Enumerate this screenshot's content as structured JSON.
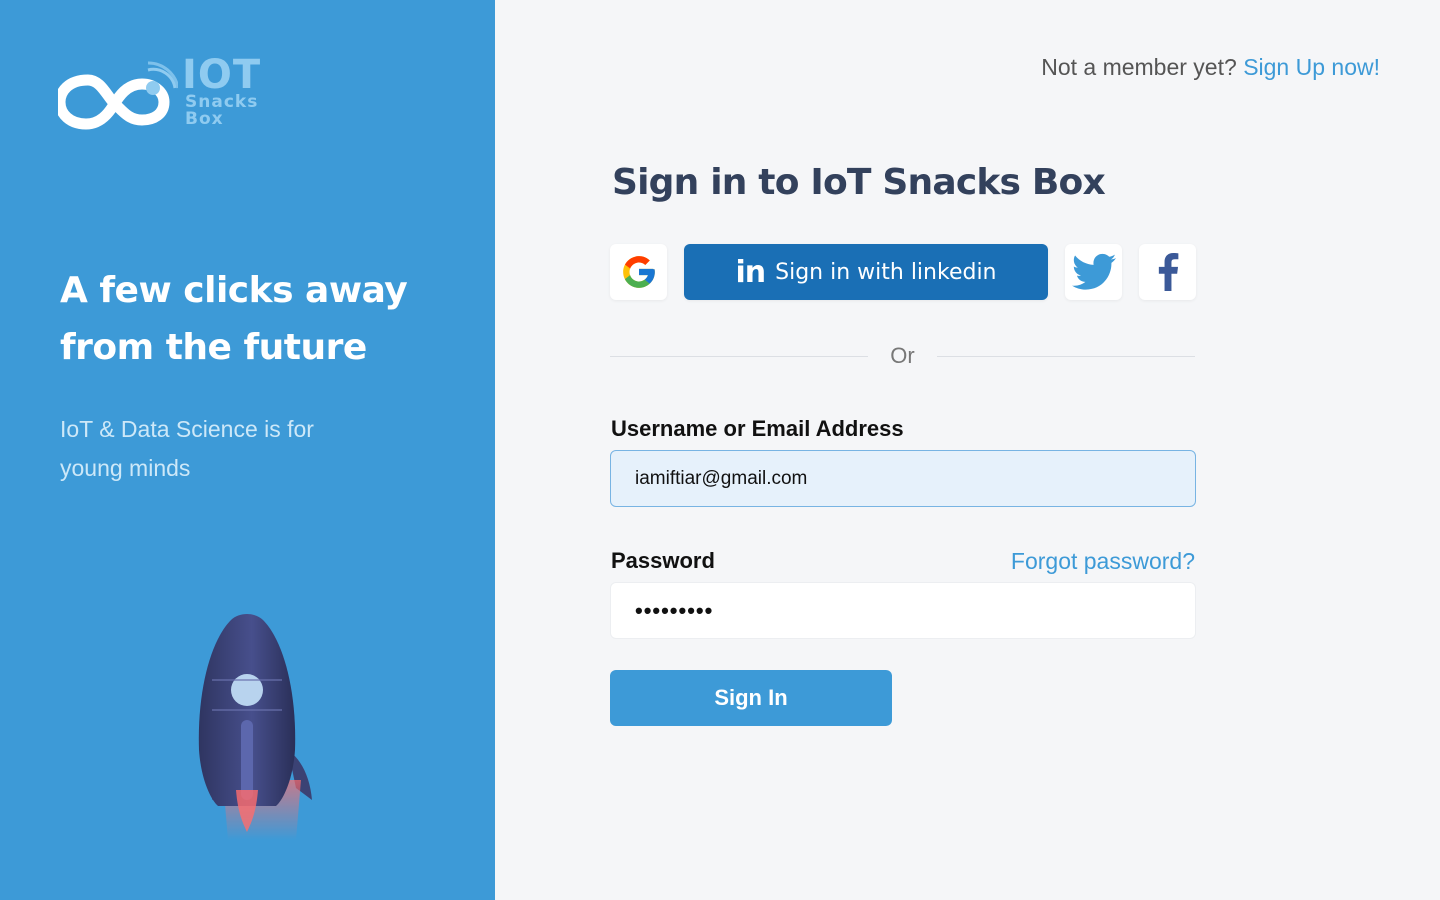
{
  "brand": {
    "logo_word": "IOT",
    "logo_sub1": "Snacks",
    "logo_sub2": "Box"
  },
  "hero": {
    "tagline_line1": "A few clicks away",
    "tagline_line2": "from the future",
    "subtag_line1": "IoT & Data Science is for",
    "subtag_line2": "young minds"
  },
  "header": {
    "prompt": "Not a member yet?",
    "signup_link": "Sign Up now!"
  },
  "form": {
    "title": "Sign in to IoT Snacks Box",
    "linkedin_icon": "in",
    "linkedin_label": "Sign in with linkedin",
    "divider_text": "Or",
    "username_label": "Username or Email Address",
    "username_value": "iamiftiar@gmail.com",
    "password_label": "Password",
    "password_value": "•••••••••",
    "forgot_link": "Forgot password?",
    "submit_label": "Sign In"
  },
  "icons": {
    "google": "google-icon",
    "twitter": "twitter-icon",
    "facebook": "facebook-icon",
    "rocket": "rocket-illustration"
  },
  "colors": {
    "primary": "#3d9ad7",
    "linkedin": "#1a6fb5",
    "title": "#33415c",
    "background": "#f5f6f8"
  }
}
